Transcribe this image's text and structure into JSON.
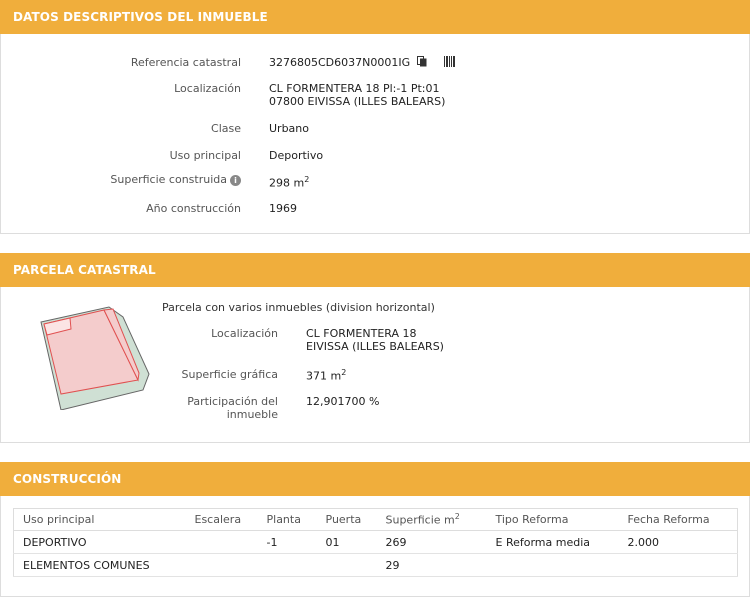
{
  "inmueble": {
    "header": "DATOS DESCRIPTIVOS DEL INMUEBLE",
    "ref_label": "Referencia catastral",
    "ref_value": "3276805CD6037N0001IG",
    "loc_label": "Localización",
    "loc_line1": "CL FORMENTERA 18 Pl:-1 Pt:01",
    "loc_line2": "07800 EIVISSA (ILLES BALEARS)",
    "clase_label": "Clase",
    "clase_value": "Urbano",
    "uso_label": "Uso principal",
    "uso_value": "Deportivo",
    "sup_label": "Superficie construida",
    "sup_value": "298 m",
    "sup_unit_exp": "2",
    "anio_label": "Año construcción",
    "anio_value": "1969"
  },
  "parcela": {
    "header": "PARCELA CATASTRAL",
    "description": "Parcela con varios inmuebles (division horizontal)",
    "loc_label": "Localización",
    "loc_line1": "CL FORMENTERA 18",
    "loc_line2": "EIVISSA (ILLES BALEARS)",
    "sup_label": "Superficie gráfica",
    "sup_value": "371 m",
    "sup_unit_exp": "2",
    "part_label_1": "Participación del",
    "part_label_2": "inmueble",
    "part_value": "12,901700 %"
  },
  "construccion": {
    "header": "CONSTRUCCIÓN",
    "columns": [
      "Uso principal",
      "Escalera",
      "Planta",
      "Puerta",
      "Superficie m",
      "Tipo Reforma",
      "Fecha Reforma"
    ],
    "sup_exp": "2",
    "rows": [
      [
        "DEPORTIVO",
        "",
        "-1",
        "01",
        "269",
        "E Reforma media",
        "2.000"
      ],
      [
        "ELEMENTOS COMUNES",
        "",
        "",
        "",
        "29",
        "",
        ""
      ]
    ]
  },
  "colors": {
    "header": "#f0ae3c",
    "parcel_fill": "#f4cccc",
    "parcel_edge": "#e05050",
    "parcel_bg": "#cfe0d4"
  }
}
